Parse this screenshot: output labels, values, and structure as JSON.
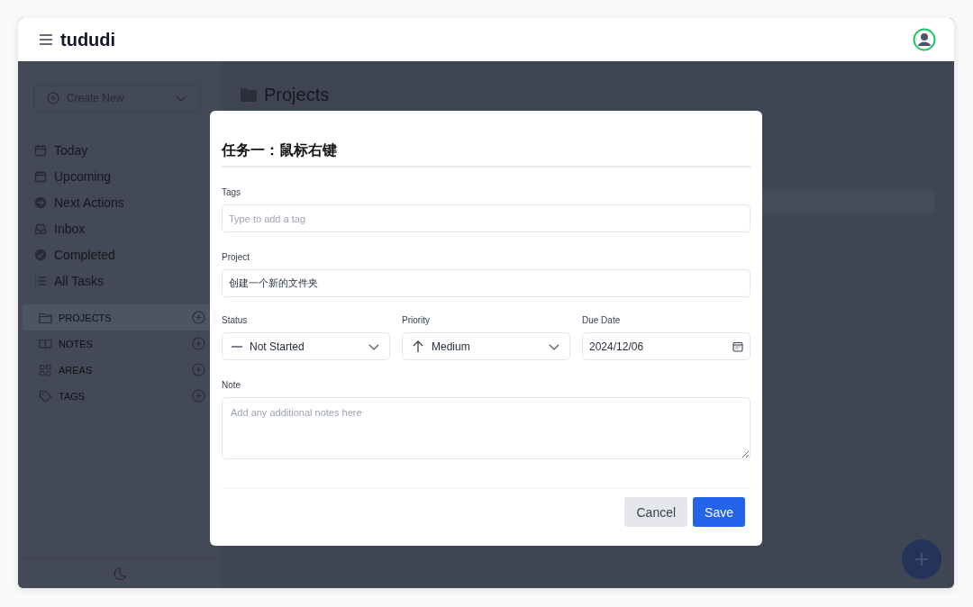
{
  "header": {
    "title": "tududi"
  },
  "sidebar": {
    "create_new": "Create New",
    "nav_items": [
      {
        "label": "Today"
      },
      {
        "label": "Upcoming"
      },
      {
        "label": "Next Actions"
      },
      {
        "label": "Inbox"
      },
      {
        "label": "Completed"
      },
      {
        "label": "All Tasks"
      }
    ],
    "sections": [
      {
        "label": "PROJECTS",
        "selected": true
      },
      {
        "label": "NOTES",
        "selected": false
      },
      {
        "label": "AREAS",
        "selected": false
      },
      {
        "label": "TAGS",
        "selected": false
      }
    ]
  },
  "main": {
    "title": "Projects"
  },
  "dialog": {
    "title": "任务一：鼠标右键",
    "tags": {
      "label": "Tags",
      "placeholder": "Type to add a tag"
    },
    "project": {
      "label": "Project",
      "value": "创建一个新的文件夹"
    },
    "status": {
      "label": "Status",
      "value": "Not Started"
    },
    "priority": {
      "label": "Priority",
      "value": "Medium"
    },
    "due_date": {
      "label": "Due Date",
      "value": "2024/12/06"
    },
    "note": {
      "label": "Note",
      "placeholder": "Add any additional notes here"
    },
    "buttons": [
      {
        "label": "Cancel",
        "kind": "secondary"
      },
      {
        "label": "Save",
        "kind": "primary"
      }
    ]
  }
}
